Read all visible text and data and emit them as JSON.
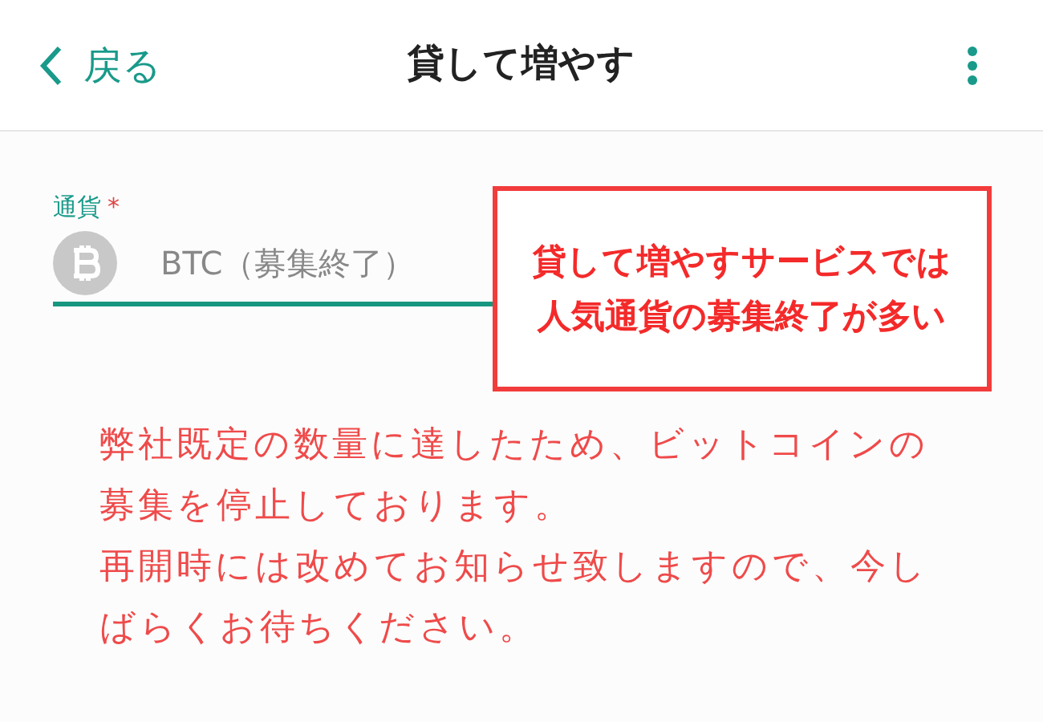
{
  "header": {
    "back_label": "戻る",
    "title": "貸して増やす"
  },
  "currency_field": {
    "label": "通貨",
    "required_mark": "*",
    "value": "BTC（募集終了）"
  },
  "notice": [
    "弊社既定の数量に達したため、ビットコインの募集を停止しております。",
    "再開時には改めてお知らせ致しますので、今しばらくお待ちください。"
  ],
  "annotation": {
    "lines": [
      "貸して増やすサービスでは",
      "人気通貨の募集終了が多い"
    ]
  }
}
